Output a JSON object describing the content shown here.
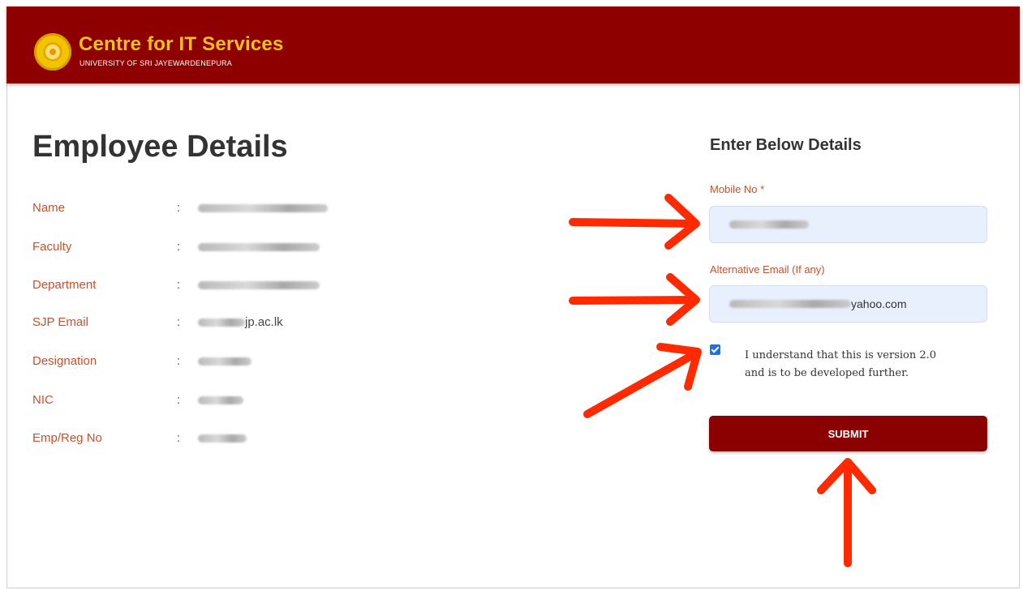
{
  "header": {
    "brand_title": "Centre for IT Services",
    "brand_subtitle": "UNIVERSITY OF SRI JAYEWARDENEPURA",
    "background_color": "#8e0000",
    "title_color": "#f3c21a"
  },
  "employee": {
    "title": "Employee Details",
    "rows": [
      {
        "label": "Name",
        "value": ""
      },
      {
        "label": "Faculty",
        "value": ""
      },
      {
        "label": "Department",
        "value": ""
      },
      {
        "label": "SJP Email",
        "value": "jp.ac.lk"
      },
      {
        "label": "Designation",
        "value": ""
      },
      {
        "label": "NIC",
        "value": ""
      },
      {
        "label": "Emp/Reg No",
        "value": ""
      }
    ],
    "separator": ":"
  },
  "form": {
    "title": "Enter Below Details",
    "mobile_label": "Mobile No *",
    "mobile_value": "",
    "email_label": "Alternative Email (If any)",
    "email_value_visible": "yahoo.com",
    "checkbox_checked": true,
    "checkbox_line1": "I understand that this is version 2.0",
    "checkbox_line2": "and is to be developed further.",
    "submit_label": "SUBMIT",
    "submit_color": "#8b0000",
    "annotation_color": "#ff2a00"
  }
}
